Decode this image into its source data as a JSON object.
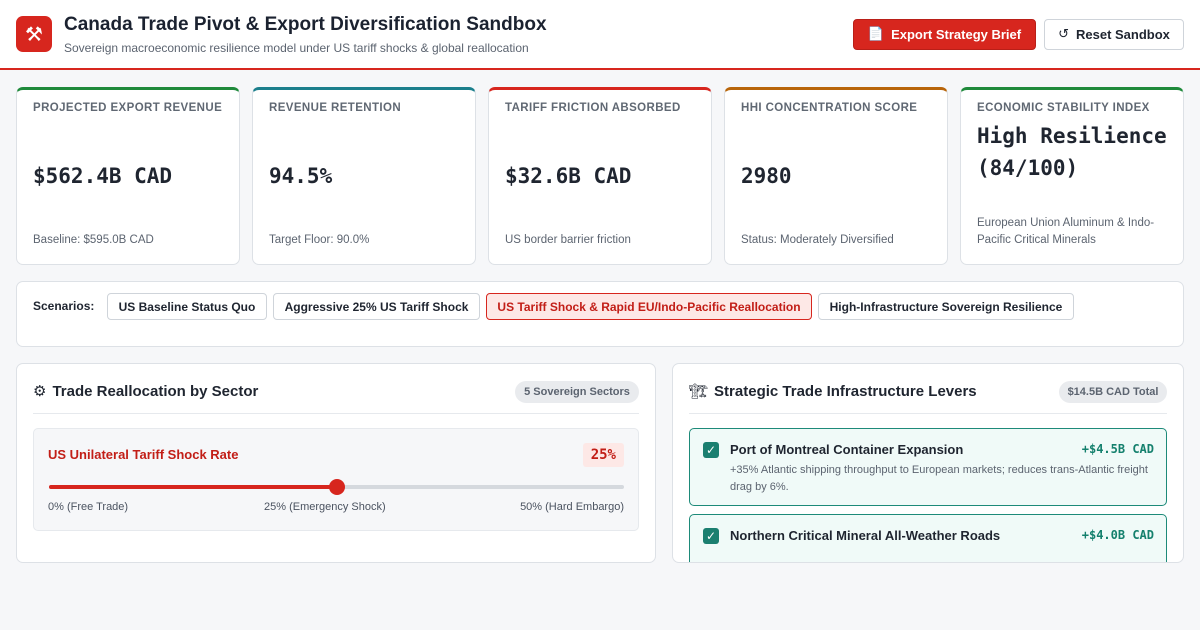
{
  "header": {
    "logo_icon": "⚒",
    "title": "Canada Trade Pivot & Export Diversification Sandbox",
    "subtitle": "Sovereign macroeconomic resilience model under US tariff shocks & global reallocation",
    "export_button": {
      "icon": "📄",
      "label": "Export Strategy Brief"
    },
    "reset_button": {
      "icon": "↺",
      "label": "Reset Sandbox"
    },
    "accent_color": "#d7261e"
  },
  "kpis": [
    {
      "label": "PROJECTED EXPORT REVENUE",
      "value": "$562.4B CAD",
      "note": "Baseline: $595.0B CAD",
      "color": "#1f8a3b"
    },
    {
      "label": "REVENUE RETENTION",
      "value": "94.5%",
      "note": "Target Floor: 90.0%",
      "color": "#1b7f8c"
    },
    {
      "label": "TARIFF FRICTION ABSORBED",
      "value": "$32.6B CAD",
      "note": "US border barrier friction",
      "color": "#d7261e"
    },
    {
      "label": "HHI CONCENTRATION SCORE",
      "value": "2980",
      "note": "Status: Moderately Diversified",
      "color": "#b8650a"
    },
    {
      "label": "ECONOMIC STABILITY INDEX",
      "value": "High Resilience (84/100)",
      "note": "European Union Aluminum & Indo-Pacific Critical Minerals",
      "color": "#1f8a3b"
    }
  ],
  "scenarios": {
    "label": "Scenarios:",
    "options": [
      "US Baseline Status Quo",
      "Aggressive 25% US Tariff Shock",
      "US Tariff Shock & Rapid EU/Indo-Pacific Reallocation",
      "High-Infrastructure Sovereign Resilience"
    ],
    "selected": "US Tariff Shock & Rapid EU/Indo-Pacific Reallocation"
  },
  "reallocation_panel": {
    "icon": "⚙",
    "title": "Trade Reallocation by Sector",
    "badge": "5 Sovereign Sectors",
    "slider": {
      "label": "US Unilateral Tariff Shock Rate",
      "value_text": "25%",
      "value_percent": 25,
      "max_percent": 50,
      "ticks": [
        "0% (Free Trade)",
        "25% (Emergency Shock)",
        "50% (Hard Embargo)"
      ]
    }
  },
  "levers_panel": {
    "icon": "🏗",
    "title": "Strategic Trade Infrastructure Levers",
    "badge": "$14.5B CAD Total",
    "levers": [
      {
        "name": "Port of Montreal Container Expansion",
        "cost": "+$4.5B CAD",
        "description": "+35% Atlantic shipping throughput to European markets; reduces trans-Atlantic freight drag by 6%.",
        "checked": true
      },
      {
        "name": "Northern Critical Mineral All-Weather Roads",
        "cost": "+$4.0B CAD",
        "description": "",
        "checked": true
      }
    ]
  }
}
